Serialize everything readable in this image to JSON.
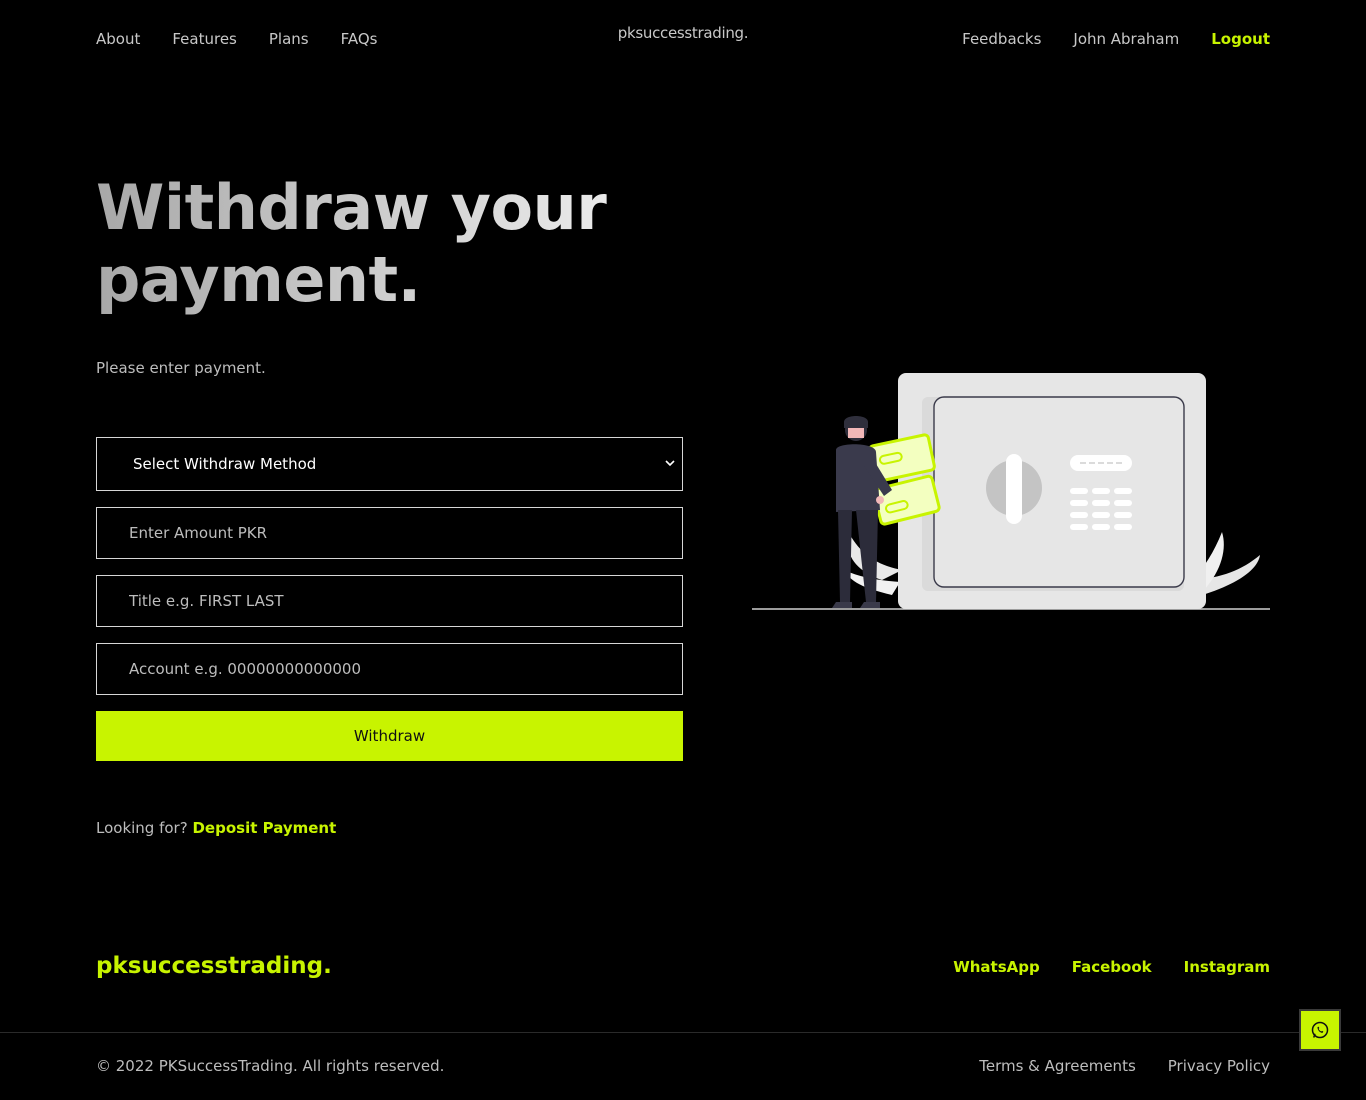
{
  "nav": {
    "left_links": [
      "About",
      "Features",
      "Plans",
      "FAQs"
    ],
    "brand": "pksuccesstrading.",
    "right_links": [
      "Feedbacks",
      "John Abraham"
    ],
    "logout": "Logout"
  },
  "hero": {
    "title": "Withdraw your payment.",
    "subtitle": "Please enter payment."
  },
  "form": {
    "method_select": {
      "selected": "Select Withdraw Method"
    },
    "amount_placeholder": "Enter Amount PKR",
    "title_placeholder": "Title e.g. FIRST LAST",
    "account_placeholder": "Account e.g. 00000000000000",
    "submit_label": "Withdraw"
  },
  "looking": {
    "prefix": "Looking for?",
    "link": "Deposit Payment"
  },
  "footer": {
    "brand": "pksuccesstrading.",
    "social": [
      "WhatsApp",
      "Facebook",
      "Instagram"
    ],
    "copyright": "© 2022 PKSuccessTrading. All rights reserved.",
    "legal": [
      "Terms & Agreements",
      "Privacy Policy"
    ]
  },
  "colors": {
    "background": "#000000",
    "accent": "#c8f400",
    "text_muted": "#bdbdbd"
  },
  "icons": {
    "floating_button": "whatsapp-icon",
    "select": "chevron-down-icon",
    "illustration": "safe-illustration"
  }
}
